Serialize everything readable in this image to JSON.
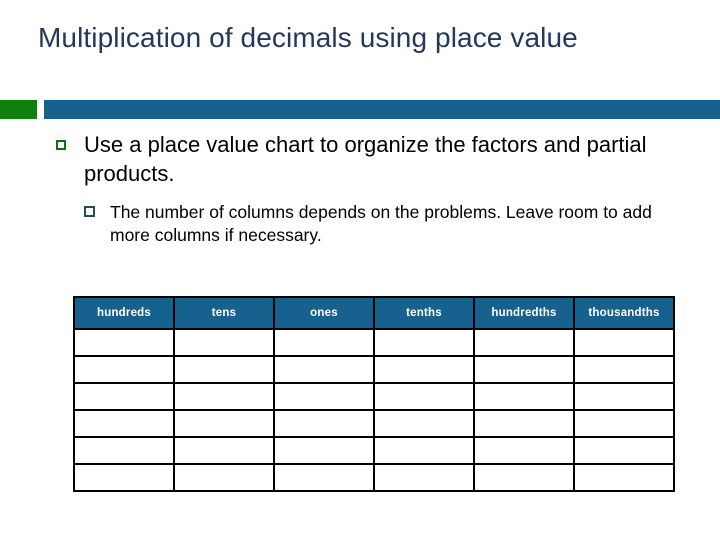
{
  "slide": {
    "title": "Multiplication of decimals using place value",
    "theme": {
      "title_color": "#23395b",
      "accent_blue": "#17618f",
      "accent_green": "#10800e",
      "bullet_l1_color": "#107010",
      "bullet_l2_color": "#1f4e5f",
      "body_text_color": "#000000",
      "background": "#ffffff"
    },
    "divider": {
      "green_block_label": "green-accent-block",
      "blue_bar_label": "blue-accent-bar"
    },
    "bullets": [
      {
        "level": 1,
        "marker": "green-hollow-square",
        "text": "Use a place value chart to organize the factors and partial products."
      },
      {
        "level": 2,
        "marker": "blue-hollow-square",
        "text": "The number of columns depends on the problems. Leave room to add more columns if necessary."
      }
    ],
    "place_value_table": {
      "headers": [
        "hundreds",
        "tens",
        "ones",
        "tenths",
        "hundredths",
        "thousandths"
      ],
      "body_row_count": 6,
      "column_count": 6,
      "cells": [
        [
          "",
          "",
          "",
          "",
          "",
          ""
        ],
        [
          "",
          "",
          "",
          "",
          "",
          ""
        ],
        [
          "",
          "",
          "",
          "",
          "",
          ""
        ],
        [
          "",
          "",
          "",
          "",
          "",
          ""
        ],
        [
          "",
          "",
          "",
          "",
          "",
          ""
        ],
        [
          "",
          "",
          "",
          "",
          "",
          ""
        ]
      ]
    }
  }
}
